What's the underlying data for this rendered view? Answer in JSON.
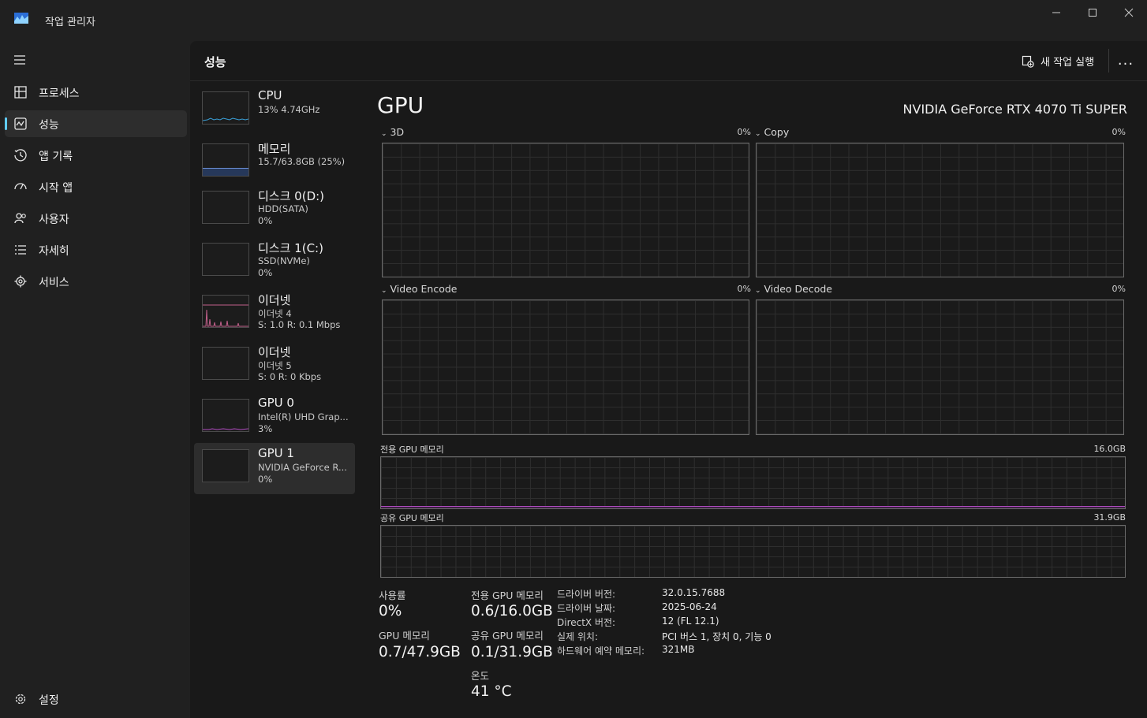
{
  "app": {
    "title": "작업 관리자"
  },
  "sidebar": {
    "menu_icon": "hamburger-icon",
    "items": [
      {
        "label": "프로세스",
        "icon": "processes-icon"
      },
      {
        "label": "성능",
        "icon": "performance-icon"
      },
      {
        "label": "앱 기록",
        "icon": "history-icon"
      },
      {
        "label": "시작 앱",
        "icon": "startup-icon"
      },
      {
        "label": "사용자",
        "icon": "users-icon"
      },
      {
        "label": "자세히",
        "icon": "details-icon"
      },
      {
        "label": "서비스",
        "icon": "services-icon"
      }
    ],
    "settings": {
      "label": "설정",
      "icon": "gear-icon"
    }
  },
  "header": {
    "title": "성능",
    "new_task": "새 작업 실행",
    "more": "..."
  },
  "perf_list": [
    {
      "title": "CPU",
      "line1": "13% 4.74GHz",
      "line2": ""
    },
    {
      "title": "메모리",
      "line1": "15.7/63.8GB (25%)",
      "line2": ""
    },
    {
      "title": "디스크 0(D:)",
      "line1": "HDD(SATA)",
      "line2": "0%"
    },
    {
      "title": "디스크 1(C:)",
      "line1": "SSD(NVMe)",
      "line2": "0%"
    },
    {
      "title": "이더넷",
      "line1": "이더넷 4",
      "line2": "S: 1.0 R: 0.1 Mbps"
    },
    {
      "title": "이더넷",
      "line1": "이더넷 5",
      "line2": "S: 0 R: 0 Kbps"
    },
    {
      "title": "GPU 0",
      "line1": "Intel(R) UHD Grap...",
      "line2": "3%"
    },
    {
      "title": "GPU 1",
      "line1": "NVIDIA GeForce R...",
      "line2": "0%"
    }
  ],
  "detail": {
    "title": "GPU",
    "device": "NVIDIA GeForce RTX 4070 Ti SUPER",
    "engines": [
      {
        "label": "3D",
        "pct": "0%"
      },
      {
        "label": "Copy",
        "pct": "0%"
      },
      {
        "label": "Video Encode",
        "pct": "0%"
      },
      {
        "label": "Video Decode",
        "pct": "0%"
      }
    ],
    "dedicated": {
      "label": "전용 GPU 메모리",
      "max": "16.0GB"
    },
    "shared": {
      "label": "공유 GPU 메모리",
      "max": "31.9GB"
    },
    "stats": {
      "utilization_label": "사용률",
      "utilization": "0%",
      "dedicated_label": "전용 GPU 메모리",
      "dedicated": "0.6/16.0GB",
      "gpu_mem_label": "GPU 메모리",
      "gpu_mem": "0.7/47.9GB",
      "shared_label": "공유 GPU 메모리",
      "shared": "0.1/31.9GB",
      "temp_label": "온도",
      "temp": "41 °C"
    },
    "info": [
      {
        "key": "드라이버 버전:",
        "value": "32.0.15.7688"
      },
      {
        "key": "드라이버 날짜:",
        "value": "2025-06-24"
      },
      {
        "key": "DirectX 버전:",
        "value": "12 (FL 12.1)"
      },
      {
        "key": "실제 위치:",
        "value": "PCI 버스 1, 장치 0, 기능 0"
      },
      {
        "key": "하드웨어 예약 메모리:",
        "value": "321MB"
      }
    ]
  },
  "colors": {
    "accent": "#60cdff",
    "cpu_line": "#3aa0d8",
    "memory_line": "#6b8fd6",
    "ethernet_line": "#c0608a",
    "gpu_line": "#b04cc0"
  }
}
